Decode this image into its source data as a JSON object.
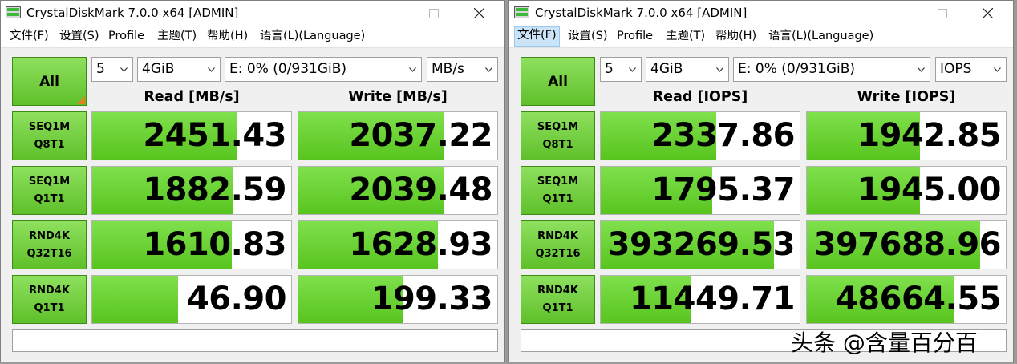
{
  "windows": [
    {
      "title": "CrystalDiskMark 7.0.0 x64 [ADMIN]",
      "menu": [
        "文件(F)",
        "设置(S)",
        "Profile",
        "主题(T)",
        "帮助(H)",
        "语言(L)(Language)"
      ],
      "all_label": "All",
      "count": "5",
      "size": "4GiB",
      "drive": "E: 0% (0/931GiB)",
      "unit": "MB/s",
      "read_header": "Read [MB/s]",
      "write_header": "Write [MB/s]",
      "tests": [
        {
          "line1": "SEQ1M",
          "line2": "Q8T1",
          "read": "2451.43",
          "write": "2037.22",
          "read_fill": 0.73,
          "write_fill": 0.73
        },
        {
          "line1": "SEQ1M",
          "line2": "Q1T1",
          "read": "1882.59",
          "write": "2039.48",
          "read_fill": 0.71,
          "write_fill": 0.73
        },
        {
          "line1": "RND4K",
          "line2": "Q32T16",
          "read": "1610.83",
          "write": "1628.93",
          "read_fill": 0.7,
          "write_fill": 0.7
        },
        {
          "line1": "RND4K",
          "line2": "Q1T1",
          "read": "46.90",
          "write": "199.33",
          "read_fill": 0.43,
          "write_fill": 0.53
        }
      ],
      "comment": ""
    },
    {
      "title": "CrystalDiskMark 7.0.0 x64 [ADMIN]",
      "menu": [
        "文件(F)",
        "设置(S)",
        "Profile",
        "主题(T)",
        "帮助(H)",
        "语言(L)(Language)"
      ],
      "all_label": "All",
      "count": "5",
      "size": "4GiB",
      "drive": "E: 0% (0/931GiB)",
      "unit": "IOPS",
      "read_header": "Read [IOPS]",
      "write_header": "Write [IOPS]",
      "tests": [
        {
          "line1": "SEQ1M",
          "line2": "Q8T1",
          "read": "2337.86",
          "write": "1942.85",
          "read_fill": 0.58,
          "write_fill": 0.57
        },
        {
          "line1": "SEQ1M",
          "line2": "Q1T1",
          "read": "1795.37",
          "write": "1945.00",
          "read_fill": 0.56,
          "write_fill": 0.57
        },
        {
          "line1": "RND4K",
          "line2": "Q32T16",
          "read": "393269.53",
          "write": "397688.96",
          "read_fill": 0.87,
          "write_fill": 0.87
        },
        {
          "line1": "RND4K",
          "line2": "Q1T1",
          "read": "11449.71",
          "write": "48664.55",
          "read_fill": 0.45,
          "write_fill": 0.74
        }
      ],
      "comment": ""
    }
  ],
  "watermark": "头条 @含量百分百"
}
